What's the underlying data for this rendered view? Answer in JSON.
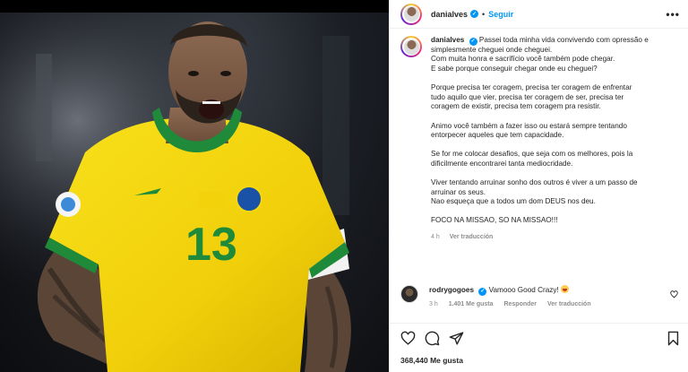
{
  "post": {
    "image_alt": "Dani Alves celebrating in Brazil jersey number 13",
    "jersey_number": "13"
  },
  "header": {
    "username": "danialves",
    "verified_icon": "verified-badge-icon",
    "separator": "•",
    "follow_label": "Seguir",
    "more_label": "•••"
  },
  "caption": {
    "username": "danialves",
    "lines": [
      "Passei toda minha vida convivendo com opressão e",
      "simplesmente cheguei onde cheguei.",
      "Com muita honra e sacrifício você também pode chegar.",
      "E sabe porque conseguir chegar onde eu cheguei?",
      "",
      "Porque precisa ter coragem, precisa ter coragem de enfrentar",
      "tudo aquilo que vier, precisa ter coragem de ser, precisa ter",
      "coragem de existir, precisa tem coragem pra resistir.",
      "",
      "Animo você também a fazer isso ou estará sempre tentando",
      "entorpecer aqueles que tem capacidade.",
      "",
      "Se for me colocar desafios, que seja com os melhores, pois la",
      "dificilmente encontrarei tanta mediocridade.",
      "",
      "Viver tentando arruinar sonho dos outros é viver a um passo de",
      "arruinar os seus.",
      "Nao esqueça que a todos um dom DEUS nos deu.",
      "",
      "FOCO NA MISSAO, SO NA MISSAO!!!"
    ],
    "time": "4 h",
    "translate_label": "Ver traducción"
  },
  "comment": {
    "username": "rodrygogoes",
    "text": "Vamooo Good Crazy!",
    "time": "3 h",
    "likes": "1.401 Me gusta",
    "reply_label": "Responder",
    "translate_label": "Ver traducción"
  },
  "actions": {
    "likes_count": "368,440 Me gusta"
  },
  "colors": {
    "accent": "#0095f6",
    "text": "#262626",
    "muted": "#8e8e8e",
    "jersey": "#f5d90a",
    "jersey_collar": "#1e8a3a"
  }
}
